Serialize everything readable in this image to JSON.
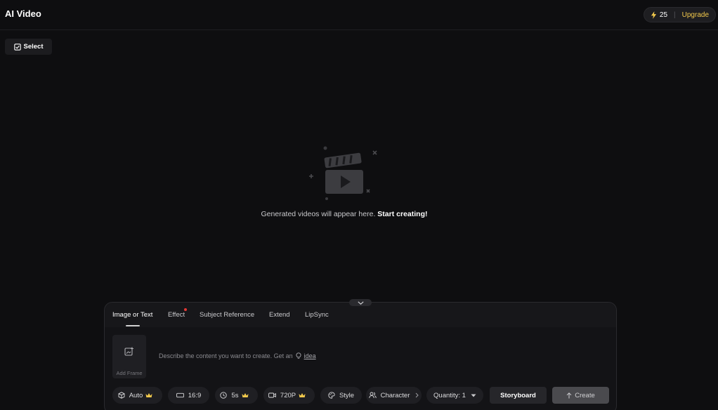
{
  "header": {
    "title": "AI Video",
    "credits": "25",
    "upgrade_label": "Upgrade"
  },
  "toolbar": {
    "select_label": "Select"
  },
  "empty_state": {
    "message": "Generated videos will appear here.",
    "cta": "Start creating!"
  },
  "panel": {
    "tabs": [
      {
        "label": "Image or Text",
        "active": true
      },
      {
        "label": "Effect",
        "active": false,
        "badge": true
      },
      {
        "label": "Subject Reference",
        "active": false
      },
      {
        "label": "Extend",
        "active": false
      },
      {
        "label": "LipSync",
        "active": false
      }
    ],
    "add_frame_label": "Add Frame",
    "prompt_placeholder": "Describe the content you want to create. Get an",
    "idea_label": "idea",
    "options": {
      "model": "Auto",
      "ratio": "16:9",
      "duration": "5s",
      "resolution": "720P",
      "style": "Style",
      "character": "Character",
      "quantity": "Quantity: 1"
    },
    "storyboard_label": "Storyboard",
    "create_label": "Create"
  },
  "colors": {
    "background": "#0e0e10",
    "accent_gold": "#f2c94c",
    "badge_red": "#e53935"
  }
}
